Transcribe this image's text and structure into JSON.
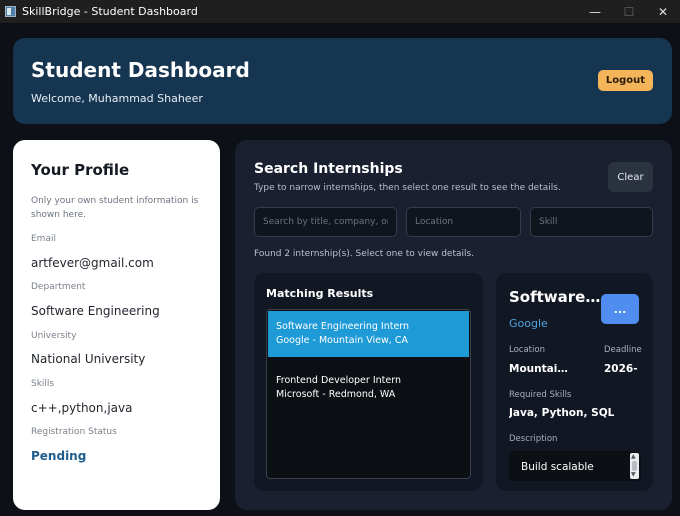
{
  "window": {
    "title": "SkillBridge - Student Dashboard",
    "controls": {
      "minimize": "—",
      "maximize": "☐",
      "close": "✕"
    }
  },
  "header": {
    "title": "Student Dashboard",
    "welcome": "Welcome, Muhammad Shaheer",
    "logout_label": "Logout"
  },
  "profile": {
    "title": "Your Profile",
    "note": "Only your own student information is shown here.",
    "fields": [
      {
        "label": "Email",
        "value": "artfever@gmail.com"
      },
      {
        "label": "Department",
        "value": "Software Engineering"
      },
      {
        "label": "University",
        "value": "National University"
      },
      {
        "label": "Skills",
        "value": "c++,python,java"
      },
      {
        "label": "Registration Status",
        "value": "Pending"
      }
    ]
  },
  "search": {
    "title": "Search Internships",
    "subtitle": "Type to narrow internships, then select one result to see the details.",
    "clear_label": "Clear",
    "query_placeholder": "Search by title, company, or keyword",
    "location_placeholder": "Location",
    "skill_placeholder": "Skill",
    "found_text": "Found 2 internship(s). Select one to view details."
  },
  "results": {
    "title": "Matching Results",
    "items": [
      {
        "title": "Software Engineering Intern",
        "subtitle": "Google - Mountain View, CA",
        "selected": true
      },
      {
        "title": "Frontend Developer Intern",
        "subtitle": "Microsoft - Redmond, WA",
        "selected": false
      }
    ]
  },
  "detail": {
    "title": "Software Engineering Intern",
    "action_label": "...",
    "company": "Google",
    "location_label": "Location",
    "location_value": "Mountain View, CA",
    "deadline_label": "Deadline",
    "deadline_value": "2026-",
    "skills_label": "Required Skills",
    "skills_value": "Java, Python, SQL",
    "description_label": "Description",
    "description_value": "Build scalable"
  },
  "colors": {
    "header_bg": "#163550",
    "logout_bg": "#f4b45a",
    "selected_row": "#1e9ad6",
    "detail_button": "#4f8ef0",
    "status_pending": "#1f5d8c"
  }
}
